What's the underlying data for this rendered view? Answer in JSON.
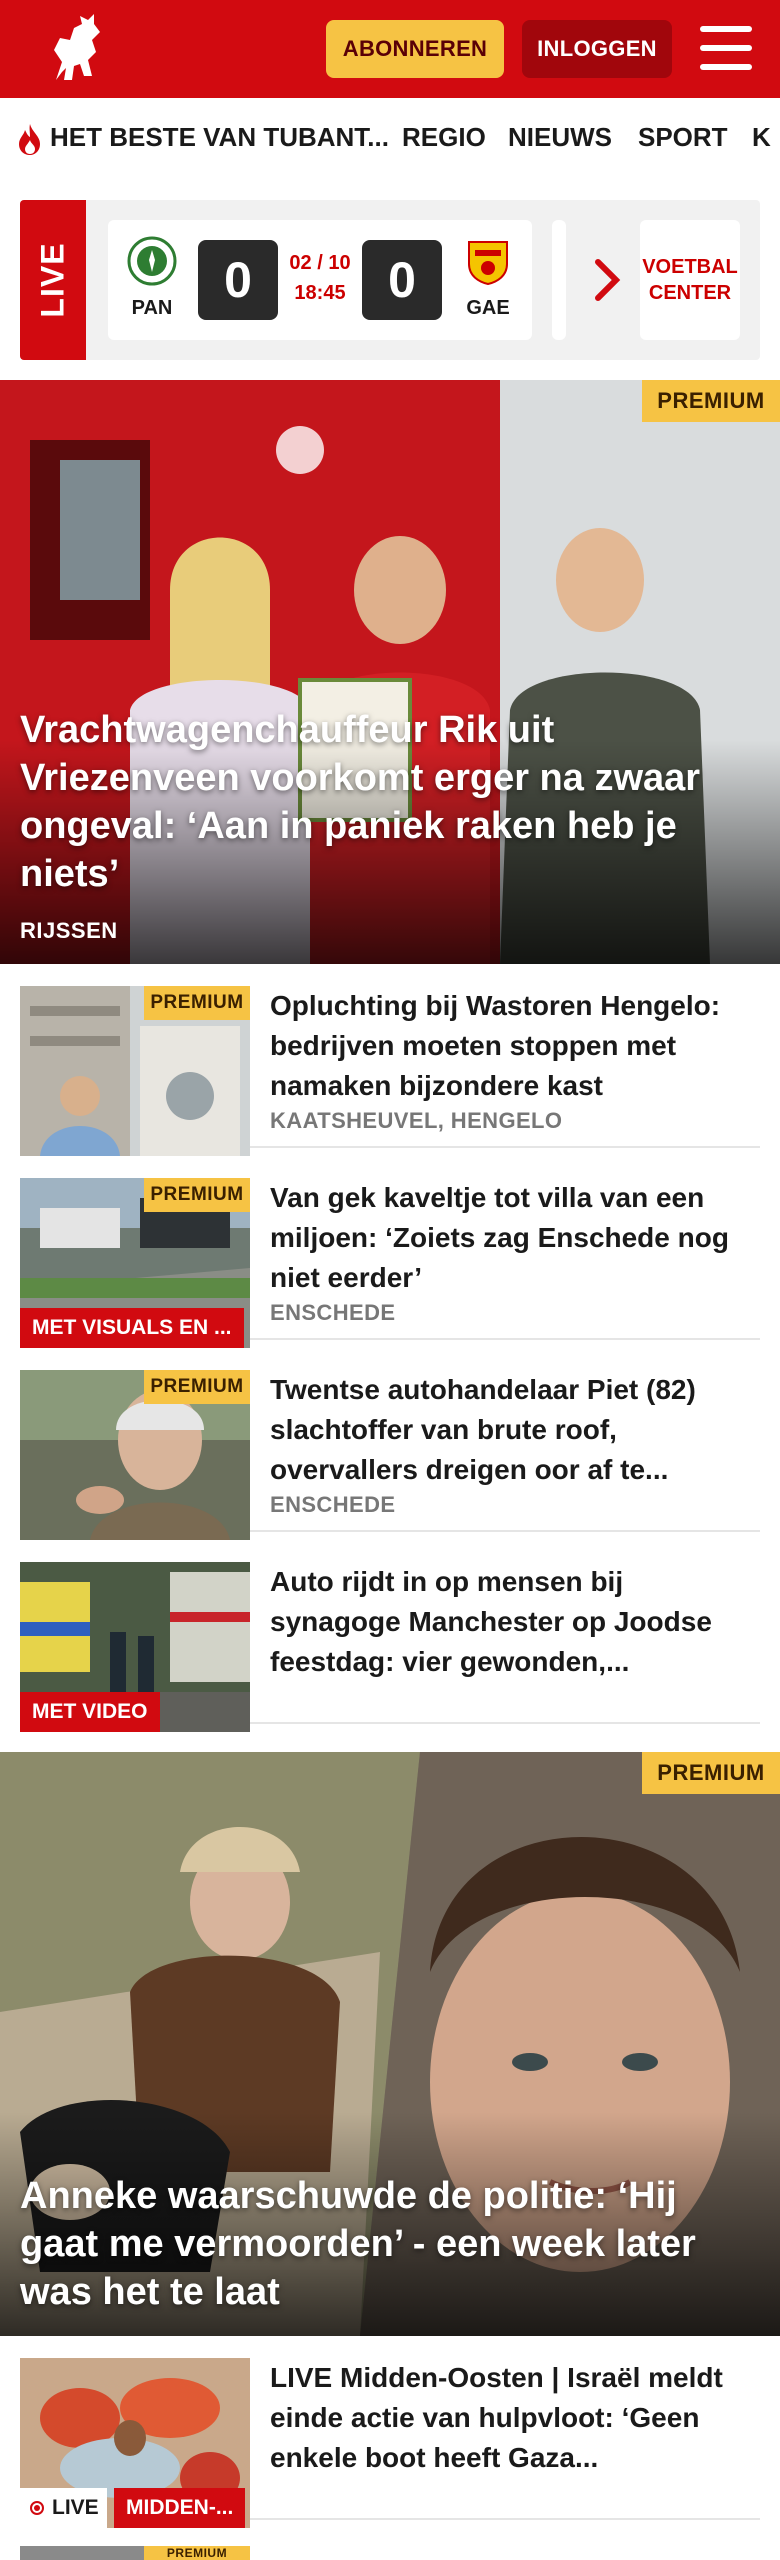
{
  "header": {
    "subscribe_label": "ABONNEREN",
    "login_label": "INLOGGEN",
    "brand_color": "#d10a10",
    "accent_color": "#f6c344"
  },
  "nav": {
    "items": [
      "HET BESTE VAN TUBANT...",
      "REGIO",
      "NIEUWS",
      "SPORT",
      "K"
    ]
  },
  "live": {
    "label": "LIVE",
    "match": {
      "home": "PAN",
      "away": "GAE",
      "home_score": "0",
      "away_score": "0",
      "date": "02 / 10",
      "time": "18:45"
    },
    "voetbal_center": "VOETBAL CENTER"
  },
  "hero1": {
    "badge": "PREMIUM",
    "title": "Vrachtwagenchauffeur Rik uit Vriezenveen voorkomt erger na zwaar ongeval: ‘Aan in paniek raken heb je niets’",
    "location": "RIJSSEN"
  },
  "articles": [
    {
      "badge": "PREMIUM",
      "title": "Opluchting bij Wastoren Hengelo: bedrijven moeten stoppen met namaken bijzondere kast",
      "location": "KAATSHEUVEL, HENGELO",
      "label": ""
    },
    {
      "badge": "PREMIUM",
      "title": "Van gek kaveltje tot villa van een miljoen: ‘Zoiets zag Enschede nog niet eerder’",
      "location": "ENSCHEDE",
      "label": "MET VISUALS EN ..."
    },
    {
      "badge": "PREMIUM",
      "title": "Twentse autohandelaar Piet (82) slachtoffer van brute roof, overvallers dreigen oor af te...",
      "location": "ENSCHEDE",
      "label": ""
    },
    {
      "badge": "",
      "title": "Auto rijdt in op mensen bij synagoge Manchester op Joodse feestdag: vier gewonden,...",
      "location": "",
      "label": "MET VIDEO"
    }
  ],
  "hero2": {
    "badge": "PREMIUM",
    "title": "Anneke waarschuwde de politie: ‘Hij gaat me vermoorden’ - een week later was het te laat"
  },
  "live_article": {
    "title": "LIVE Midden-Oosten | Israël meldt einde actie van hulpvloot: ‘Geen enkele boot heeft Gaza...",
    "live_label": "LIVE",
    "tag": "MIDDEN-...",
    "next_badge": "PREMIUM"
  }
}
